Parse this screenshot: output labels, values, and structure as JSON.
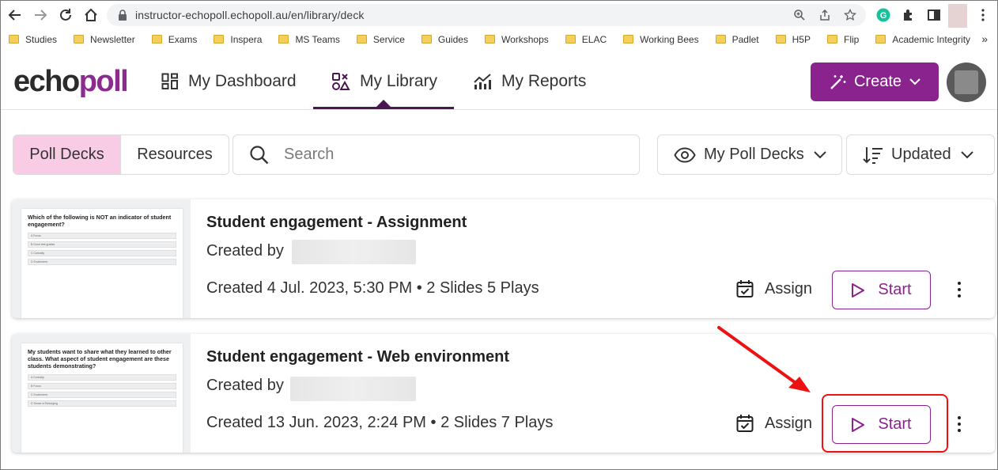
{
  "browser": {
    "url": "instructor-echopoll.echopoll.au/en/library/deck",
    "bookmarks": [
      "Studies",
      "Newsletter",
      "Exams",
      "Inspera",
      "MS Teams",
      "Service",
      "Guides",
      "Workshops",
      "ELAC",
      "Working Bees",
      "Padlet",
      "H5P",
      "Flip",
      "Academic Integrity"
    ],
    "more": "»"
  },
  "app": {
    "logo_part1": "echo",
    "logo_part2": "poll",
    "nav": {
      "dashboard": "My Dashboard",
      "library": "My Library",
      "reports": "My Reports"
    },
    "create_label": "Create"
  },
  "toolbar": {
    "tab_poll_decks": "Poll Decks",
    "tab_resources": "Resources",
    "search_placeholder": "Search",
    "filter_label": "My Poll Decks",
    "sort_label": "Updated"
  },
  "decks": [
    {
      "title": "Student engagement - Assignment",
      "created_by": "Created by",
      "meta": "Created 4 Jul. 2023, 5:30 PM • 2 Slides 5 Plays",
      "assign": "Assign",
      "start": "Start",
      "thumb_question": "Which of the following is NOT an indicator of student engagement?",
      "thumb_options": [
        "A  Focus",
        "B  Good test grades",
        "C  Curiosity",
        "D  Excitement"
      ]
    },
    {
      "title": "Student engagement - Web environment",
      "created_by": "Created by",
      "meta": "Created 13 Jun. 2023, 2:24 PM • 2 Slides 7 Plays",
      "assign": "Assign",
      "start": "Start",
      "thumb_question": "My students want to share what they learned to other class. What aspect of student engagement are these students demonstrating?",
      "thumb_options": [
        "A  Curiosity",
        "B  Focus",
        "C  Excitement",
        "D  Sense of Belonging"
      ]
    }
  ],
  "colors": {
    "brand": "#8b238f",
    "nav_active": "#4a1750",
    "tab_active_bg": "#f9cce6",
    "annotation": "#e11111"
  }
}
